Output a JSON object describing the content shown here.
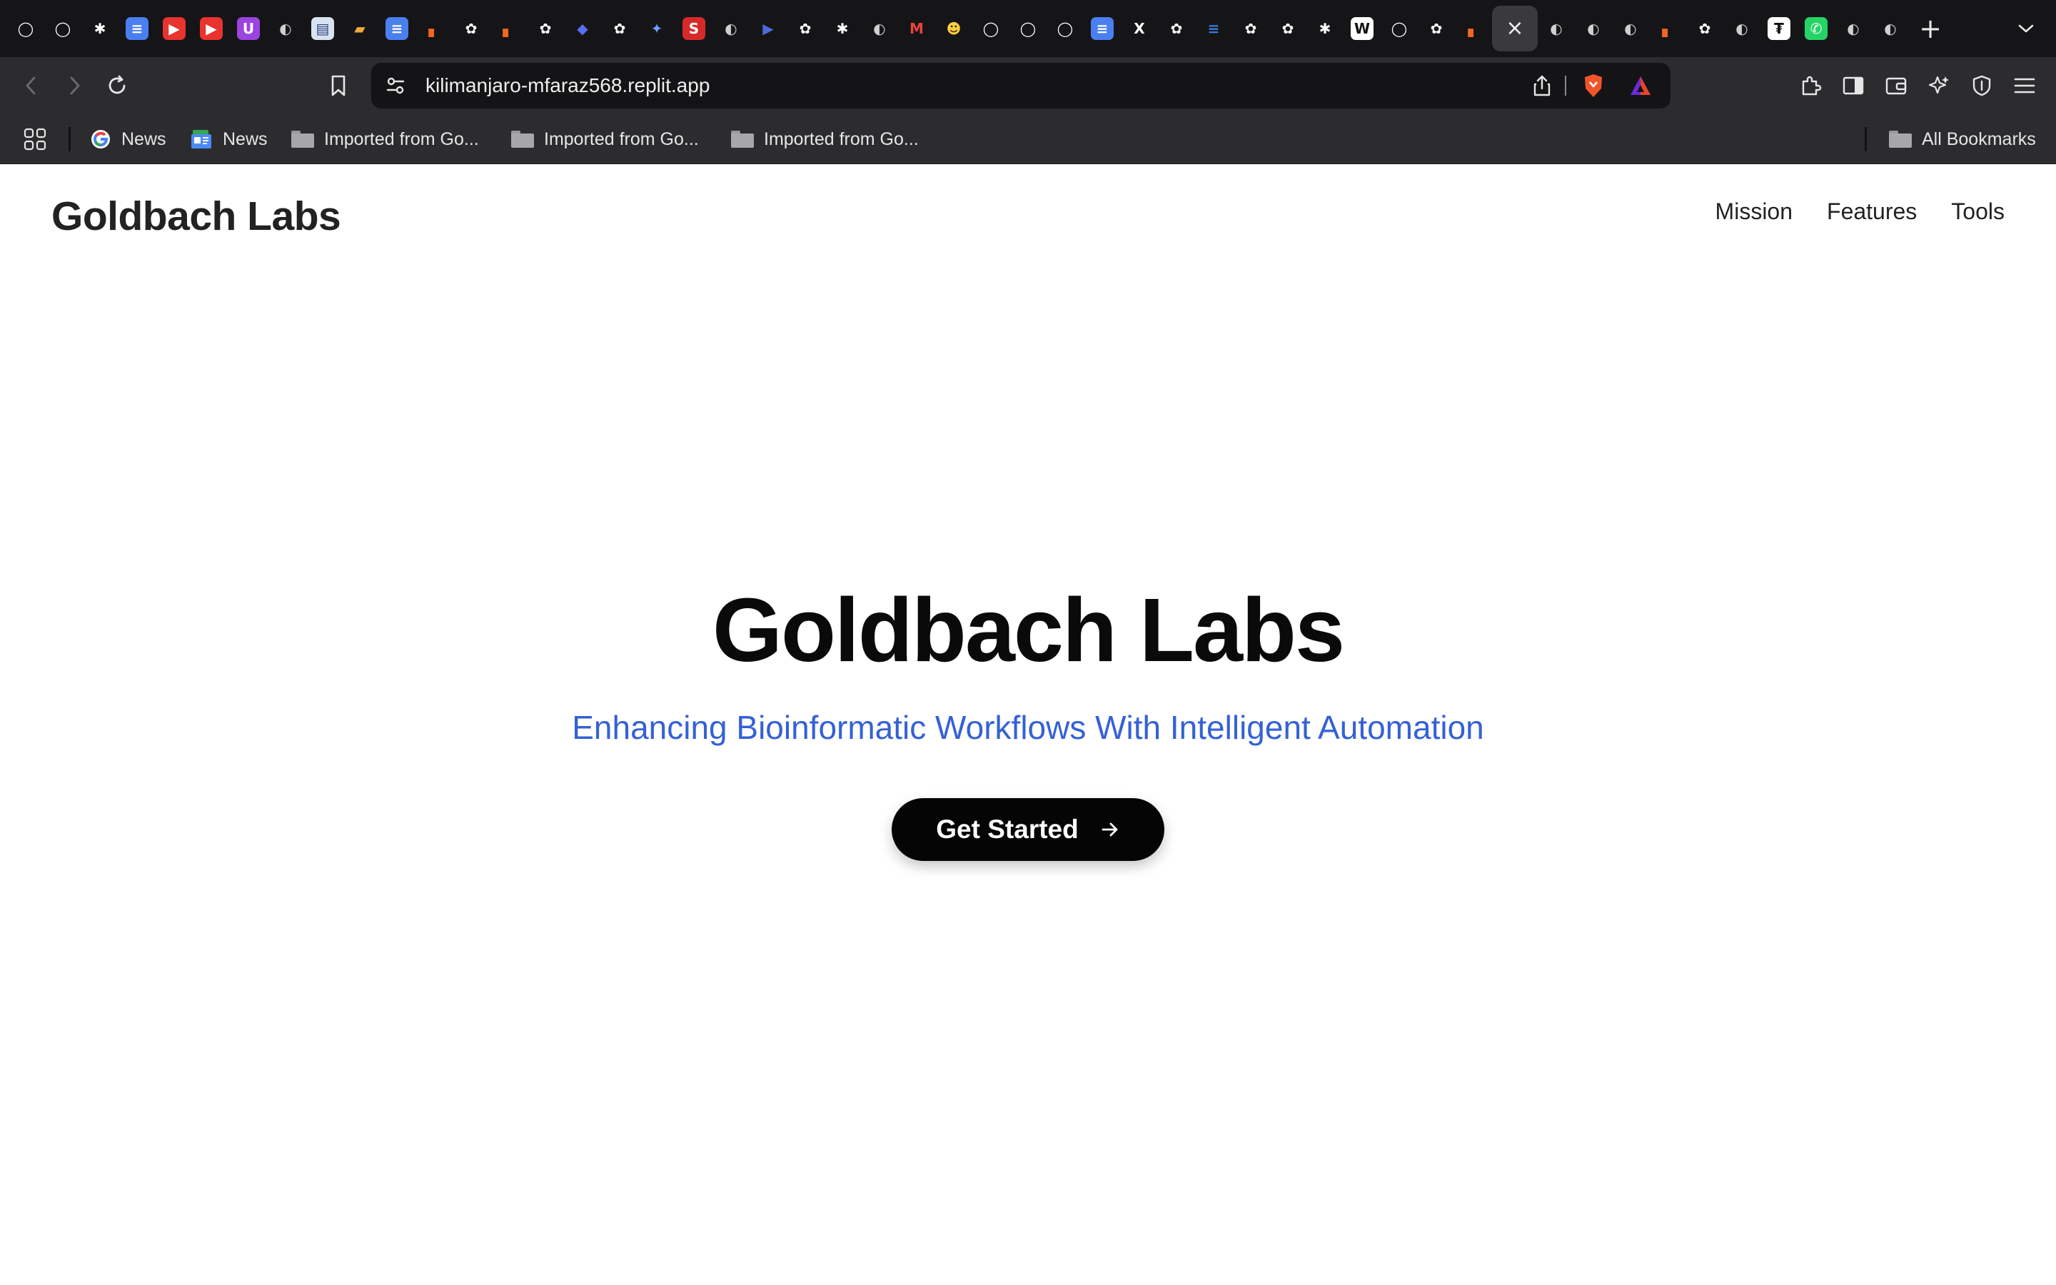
{
  "browser": {
    "tabs": [
      {
        "icon": "github-icon",
        "glyph": "◯",
        "bg": "#151517",
        "fg": "#ffffff"
      },
      {
        "icon": "github-icon",
        "glyph": "◯",
        "bg": "#151517",
        "fg": "#ffffff"
      },
      {
        "icon": "perplexity-icon",
        "glyph": "✱",
        "bg": "#151517",
        "fg": "#ffffff"
      },
      {
        "icon": "google-docs-icon",
        "glyph": "≡",
        "bg": "#4a7ff0",
        "fg": "#ffffff"
      },
      {
        "icon": "youtube-icon",
        "glyph": "▶",
        "bg": "#e8332f",
        "fg": "#ffffff"
      },
      {
        "icon": "youtube-icon",
        "glyph": "▶",
        "bg": "#e8332f",
        "fg": "#ffffff"
      },
      {
        "icon": "udemy-icon",
        "glyph": "U",
        "bg": "#9c44e0",
        "fg": "#ffffff"
      },
      {
        "icon": "globe-icon",
        "glyph": "◐",
        "bg": "#151517",
        "fg": "#d0d0d0"
      },
      {
        "icon": "site-icon",
        "glyph": "▤",
        "bg": "#d8e3f2",
        "fg": "#2a3f7a"
      },
      {
        "icon": "stack-icon",
        "glyph": "▰",
        "bg": "#151517",
        "fg": "#f2a73a"
      },
      {
        "icon": "google-docs-icon",
        "glyph": "≡",
        "bg": "#4a7ff0",
        "fg": "#ffffff"
      },
      {
        "icon": "replit-icon",
        "glyph": "▖",
        "bg": "#151517",
        "fg": "#f26522"
      },
      {
        "icon": "openai-icon",
        "glyph": "✿",
        "bg": "#151517",
        "fg": "#ffffff"
      },
      {
        "icon": "replit-icon",
        "glyph": "▖",
        "bg": "#151517",
        "fg": "#f26522"
      },
      {
        "icon": "openai-icon",
        "glyph": "✿",
        "bg": "#151517",
        "fg": "#ffffff"
      },
      {
        "icon": "bird-icon",
        "glyph": "◆",
        "bg": "#151517",
        "fg": "#5b6df0"
      },
      {
        "icon": "openai-icon",
        "glyph": "✿",
        "bg": "#151517",
        "fg": "#ffffff"
      },
      {
        "icon": "gemini-icon",
        "glyph": "✦",
        "bg": "#151517",
        "fg": "#6aa0ff"
      },
      {
        "icon": "scribd-icon",
        "glyph": "S",
        "bg": "#d62a2a",
        "fg": "#ffffff"
      },
      {
        "icon": "globe-icon",
        "glyph": "◐",
        "bg": "#151517",
        "fg": "#d0d0d0"
      },
      {
        "icon": "play-icon",
        "glyph": "▶",
        "bg": "#151517",
        "fg": "#4a6bd8"
      },
      {
        "icon": "openai-icon",
        "glyph": "✿",
        "bg": "#151517",
        "fg": "#ffffff"
      },
      {
        "icon": "perplexity-icon",
        "glyph": "✱",
        "bg": "#151517",
        "fg": "#ffffff"
      },
      {
        "icon": "globe-icon",
        "glyph": "◐",
        "bg": "#151517",
        "fg": "#d0d0d0"
      },
      {
        "icon": "gmail-icon",
        "glyph": "M",
        "bg": "#151517",
        "fg": "#e8453c"
      },
      {
        "icon": "huggingface-icon",
        "glyph": "☻",
        "bg": "#151517",
        "fg": "#ffcc3d"
      },
      {
        "icon": "github-icon",
        "glyph": "◯",
        "bg": "#151517",
        "fg": "#ffffff"
      },
      {
        "icon": "octocat-icon",
        "glyph": "◯",
        "bg": "#151517",
        "fg": "#ffffff"
      },
      {
        "icon": "github-icon",
        "glyph": "◯",
        "bg": "#151517",
        "fg": "#ffffff"
      },
      {
        "icon": "google-docs-icon",
        "glyph": "≡",
        "bg": "#4a7ff0",
        "fg": "#ffffff"
      },
      {
        "icon": "x-icon",
        "glyph": "X",
        "bg": "#151517",
        "fg": "#ffffff"
      },
      {
        "icon": "openai-icon",
        "glyph": "✿",
        "bg": "#151517",
        "fg": "#ffffff"
      },
      {
        "icon": "lines-icon",
        "glyph": "≡",
        "bg": "#151517",
        "fg": "#3d7be0"
      },
      {
        "icon": "openai-icon",
        "glyph": "✿",
        "bg": "#151517",
        "fg": "#ffffff"
      },
      {
        "icon": "openai-icon",
        "glyph": "✿",
        "bg": "#151517",
        "fg": "#ffffff"
      },
      {
        "icon": "perplexity-icon",
        "glyph": "✱",
        "bg": "#151517",
        "fg": "#ffffff"
      },
      {
        "icon": "wikipedia-icon",
        "glyph": "W",
        "bg": "#ffffff",
        "fg": "#111111"
      },
      {
        "icon": "github-icon",
        "glyph": "◯",
        "bg": "#151517",
        "fg": "#ffffff"
      },
      {
        "icon": "openai-icon",
        "glyph": "✿",
        "bg": "#151517",
        "fg": "#ffffff"
      },
      {
        "icon": "replit-icon",
        "glyph": "▖",
        "bg": "#151517",
        "fg": "#f26522"
      },
      {
        "icon": "close-icon",
        "glyph": "×",
        "bg": "transparent",
        "fg": "#f2f2f2",
        "active": true
      },
      {
        "icon": "globe-icon",
        "glyph": "◐",
        "bg": "#151517",
        "fg": "#d0d0d0"
      },
      {
        "icon": "globe-icon",
        "glyph": "◐",
        "bg": "#151517",
        "fg": "#d0d0d0"
      },
      {
        "icon": "globe-icon",
        "glyph": "◐",
        "bg": "#151517",
        "fg": "#d0d0d0"
      },
      {
        "icon": "replit-icon",
        "glyph": "▖",
        "bg": "#151517",
        "fg": "#f26522"
      },
      {
        "icon": "openai-icon",
        "glyph": "✿",
        "bg": "#151517",
        "fg": "#ffffff"
      },
      {
        "icon": "globe-icon",
        "glyph": "◐",
        "bg": "#151517",
        "fg": "#d0d0d0"
      },
      {
        "icon": "tether-icon",
        "glyph": "₮",
        "bg": "#ffffff",
        "fg": "#111111"
      },
      {
        "icon": "whatsapp-icon",
        "glyph": "✆",
        "bg": "#25d366",
        "fg": "#ffffff"
      },
      {
        "icon": "globe-icon",
        "glyph": "◐",
        "bg": "#151517",
        "fg": "#d0d0d0"
      },
      {
        "icon": "globe-icon",
        "glyph": "◐",
        "bg": "#151517",
        "fg": "#d0d0d0"
      }
    ],
    "new_tab_glyph": "+",
    "address": {
      "url": "kilimanjaro-mfaraz568.replit.app"
    },
    "bookmarks": {
      "items": [
        {
          "label": "News",
          "icon": "google-icon"
        },
        {
          "label": "News",
          "icon": "google-news-icon"
        },
        {
          "label": "Imported from Go...",
          "icon": "folder-icon"
        },
        {
          "label": "Imported from Go...",
          "icon": "folder-icon"
        },
        {
          "label": "Imported from Go...",
          "icon": "folder-icon"
        }
      ],
      "all_bookmarks_label": "All Bookmarks"
    }
  },
  "site": {
    "logo": "Goldbach Labs",
    "nav": [
      "Mission",
      "Features",
      "Tools"
    ],
    "hero": {
      "title": "Goldbach Labs",
      "subtitle": "Enhancing Bioinformatic Workflows With Intelligent Automation",
      "cta_label": "Get Started"
    }
  }
}
